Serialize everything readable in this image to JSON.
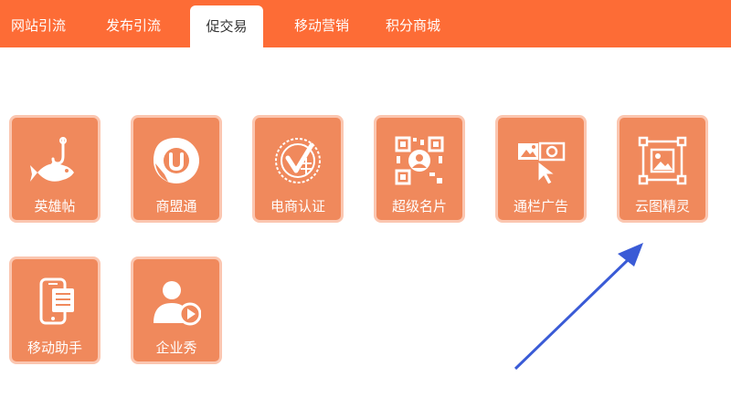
{
  "nav": {
    "background": "#fd6c36",
    "tabs": [
      {
        "label": "网站引流",
        "active": false
      },
      {
        "label": "发布引流",
        "active": false
      },
      {
        "label": "促交易",
        "active": true
      },
      {
        "label": "移动营销",
        "active": false
      },
      {
        "label": "积分商城",
        "active": false
      }
    ]
  },
  "tiles": [
    {
      "label": "英雄帖",
      "icon": "fish-hook-icon"
    },
    {
      "label": "商盟通",
      "icon": "u-logo-icon"
    },
    {
      "label": "电商认证",
      "icon": "certification-seal-icon"
    },
    {
      "label": "超级名片",
      "icon": "qr-profile-icon"
    },
    {
      "label": "通栏广告",
      "icon": "banner-ad-cursor-icon"
    },
    {
      "label": "云图精灵",
      "icon": "image-frame-icon"
    },
    {
      "label": "移动助手",
      "icon": "mobile-phone-icon"
    },
    {
      "label": "企业秀",
      "icon": "person-play-icon"
    }
  ],
  "colors": {
    "tile": "#f0895c",
    "tile_border": "#fbc6b0",
    "arrow": "#3a5bd6"
  }
}
